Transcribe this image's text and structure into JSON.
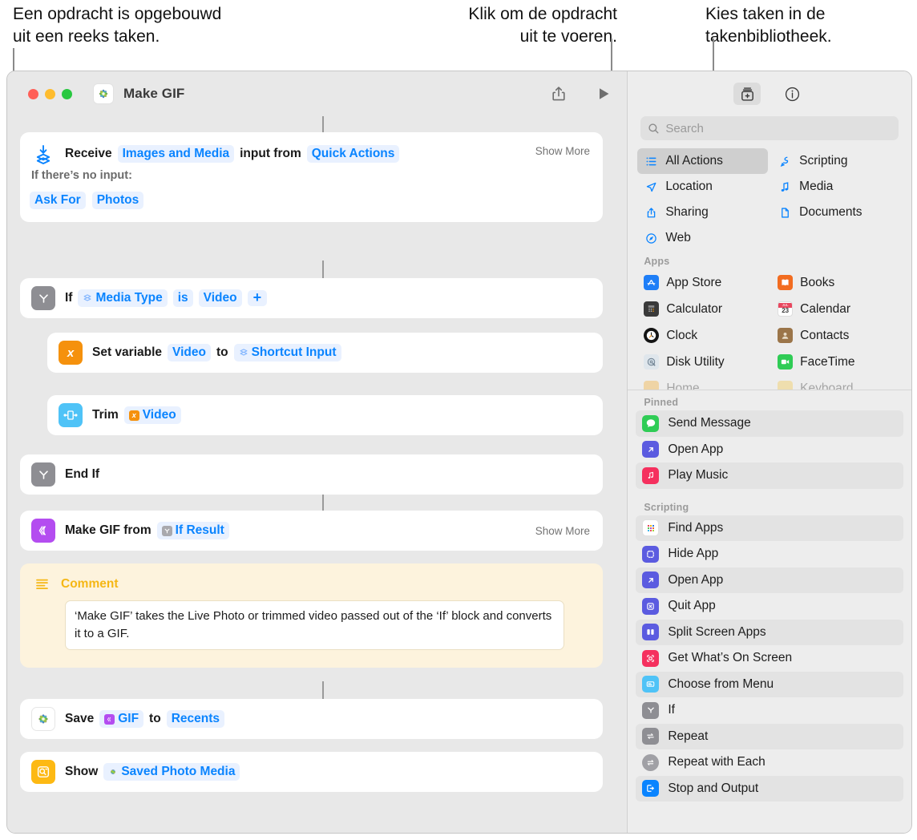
{
  "callouts": [
    {
      "id": "callout-structure",
      "text": "Een opdracht is opgebouwd\nuit een reeks taken."
    },
    {
      "id": "callout-run",
      "text": "Klik om de opdracht\nuit te voeren."
    },
    {
      "id": "callout-library",
      "text": "Kies taken in de\ntakenbibliotheek."
    }
  ],
  "window": {
    "title": "Make GIF",
    "title_icon": "photos-icon",
    "traffic_lights": [
      "close",
      "minimize",
      "zoom"
    ],
    "toolbar": {
      "share_label": "share-icon",
      "run_label": "play-icon"
    }
  },
  "workflow": {
    "rows": [
      {
        "name": "receive-input-action",
        "icon": "receive-input-icon",
        "prefix": "Receive",
        "token1": "Images and Media",
        "middle": "input from",
        "token2": "Quick Actions",
        "show_more": "Show More",
        "sub_label": "If there’s no input:",
        "sub_tokens": [
          "Ask For",
          "Photos"
        ]
      },
      {
        "name": "if-action",
        "icon": "if-icon",
        "prefix": "If",
        "token1": "Media Type",
        "middle": "is",
        "token2": "Video",
        "plus": "+"
      },
      {
        "name": "set-variable-action",
        "icon": "variable-icon",
        "prefix": "Set variable",
        "token1": "Video",
        "middle": "to",
        "token2": "Shortcut Input"
      },
      {
        "name": "trim-action",
        "icon": "trim-media-icon",
        "prefix": "Trim",
        "token1": "Video"
      },
      {
        "name": "end-if-action",
        "icon": "if-icon",
        "prefix": "End If"
      },
      {
        "name": "make-gif-action",
        "icon": "make-gif-icon",
        "prefix": "Make GIF from",
        "token1": "If Result",
        "show_more": "Show More"
      }
    ],
    "comment": {
      "name": "comment-action",
      "icon": "comment-icon",
      "title": "Comment",
      "body": "‘Make GIF’ takes the Live Photo or trimmed video passed out of the ‘If’ block and converts it to a GIF."
    },
    "save_row": {
      "name": "save-to-photo-album-action",
      "icon": "photos-icon",
      "prefix": "Save",
      "token1": "GIF",
      "middle": "to",
      "token2": "Recents"
    },
    "show_row": {
      "name": "quick-look-action",
      "icon": "quick-look-icon",
      "prefix": "Show",
      "token1": "Saved Photo Media"
    }
  },
  "library": {
    "toolbar": {
      "add_action_label": "action-library-icon",
      "info_label": "info-icon"
    },
    "search": {
      "placeholder": "Search",
      "value": "",
      "icon": "search-icon"
    },
    "categories": [
      {
        "label": "All Actions",
        "icon": "list-icon",
        "selected": true
      },
      {
        "label": "Scripting",
        "icon": "scripting-icon",
        "selected": false
      },
      {
        "label": "Location",
        "icon": "location-arrow-icon",
        "selected": false
      },
      {
        "label": "Media",
        "icon": "music-note-icon",
        "selected": false
      },
      {
        "label": "Sharing",
        "icon": "share-icon",
        "selected": false
      },
      {
        "label": "Documents",
        "icon": "document-icon",
        "selected": false
      },
      {
        "label": "Web",
        "icon": "safari-compass-icon",
        "selected": false
      }
    ],
    "apps_section_label": "Apps",
    "apps": [
      {
        "label": "App Store",
        "icon": "app-store-icon",
        "color": "#1e7ef7"
      },
      {
        "label": "Books",
        "icon": "books-icon",
        "color": "#f26c20"
      },
      {
        "label": "Calculator",
        "icon": "calculator-icon",
        "color": "#3a3a3a"
      },
      {
        "label": "Calendar",
        "icon": "calendar-icon",
        "color": "#ffffff"
      },
      {
        "label": "Clock",
        "icon": "clock-icon",
        "color": "#141414"
      },
      {
        "label": "Contacts",
        "icon": "contacts-icon",
        "color": "#9b7549"
      },
      {
        "label": "Disk Utility",
        "icon": "disk-utility-icon",
        "color": "#dfe6ec"
      },
      {
        "label": "FaceTime",
        "icon": "facetime-icon",
        "color": "#2fcc55"
      }
    ],
    "pinned_section_label": "Pinned",
    "pinned": [
      {
        "label": "Send Message",
        "icon": "messages-icon",
        "color": "#2fcc55"
      },
      {
        "label": "Open App",
        "icon": "open-app-icon",
        "color": "#5b5be0"
      },
      {
        "label": "Play Music",
        "icon": "music-icon",
        "color": "#f5305e"
      }
    ],
    "scripting_section_label": "Scripting",
    "scripting": [
      {
        "label": "Find Apps",
        "icon": "find-apps-icon",
        "color": "#ffffff"
      },
      {
        "label": "Hide App",
        "icon": "hide-app-icon",
        "color": "#5b5be0"
      },
      {
        "label": "Open App",
        "icon": "open-app-icon",
        "color": "#5b5be0"
      },
      {
        "label": "Quit App",
        "icon": "quit-app-icon",
        "color": "#5b5be0"
      },
      {
        "label": "Split Screen Apps",
        "icon": "split-screen-icon",
        "color": "#5b5be0"
      },
      {
        "label": "Get What’s On Screen",
        "icon": "get-on-screen-icon",
        "color": "#f5305e"
      },
      {
        "label": "Choose from Menu",
        "icon": "choose-menu-icon",
        "color": "#4fc3f7"
      },
      {
        "label": "If",
        "icon": "if-icon",
        "color": "#8e8e93"
      },
      {
        "label": "Repeat",
        "icon": "repeat-icon",
        "color": "#8e8e93"
      },
      {
        "label": "Repeat with Each",
        "icon": "repeat-each-icon",
        "color": "#a0a0a5"
      },
      {
        "label": "Stop and Output",
        "icon": "stop-output-icon",
        "color": "#0a84ff"
      }
    ]
  },
  "colors": {
    "accent_blue": "#0a84ff",
    "token_bg": "#e9f1ff",
    "window_bg": "#e8e8e8",
    "library_bg": "#ededed",
    "comment_bg": "#fdf3dd",
    "comment_accent": "#f5b715"
  }
}
